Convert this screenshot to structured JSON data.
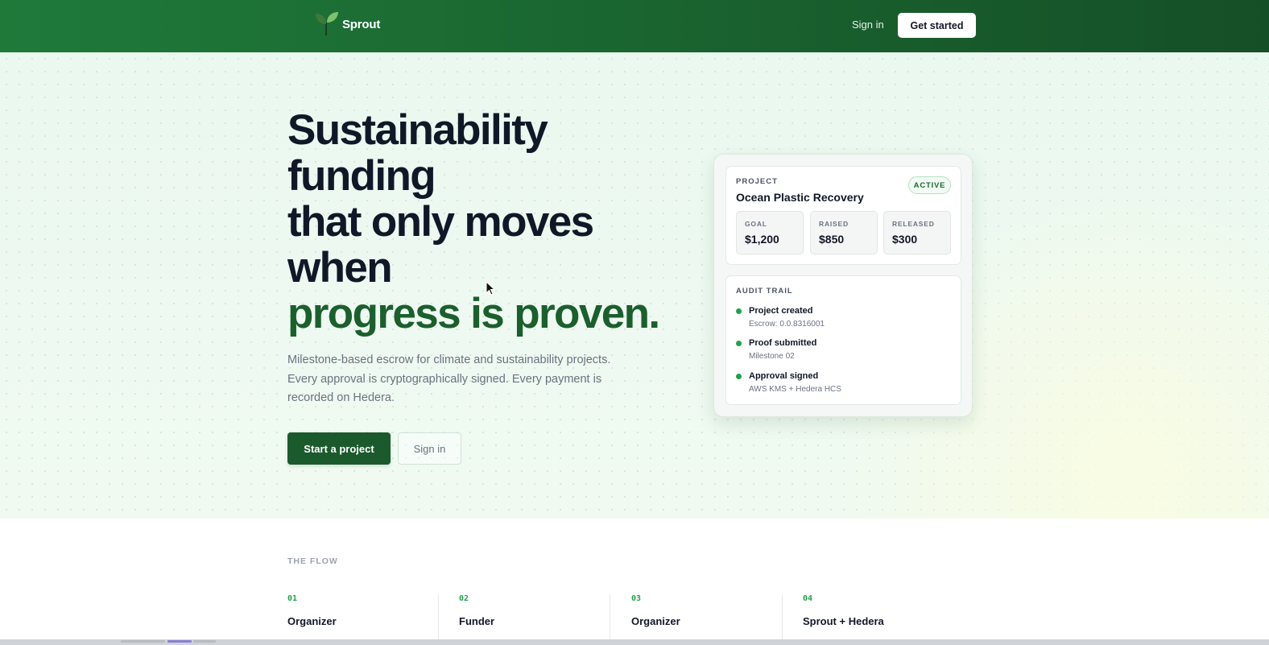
{
  "nav": {
    "brand_name": "Sprout",
    "brand_icon": "sprout-leaf-icon",
    "sign_in": "Sign in",
    "cta": "Get started"
  },
  "hero": {
    "headline_lines": [
      "Sustainability",
      "funding",
      "that only moves",
      "when"
    ],
    "headline_accent": "progress is proven.",
    "subtext": "Milestone-based escrow for climate and sustainability projects. Every approval is cryptographically signed. Every payment is recorded on Hedera.",
    "primary_button": "Start a project",
    "secondary_button": "Sign in"
  },
  "card": {
    "project_eyebrow": "PROJECT",
    "project_name": "Ocean Plastic Recovery",
    "status_badge": "ACTIVE",
    "stats": [
      {
        "label": "GOAL",
        "value": "$1,200"
      },
      {
        "label": "RAISED",
        "value": "$850"
      },
      {
        "label": "RELEASED",
        "value": "$300"
      }
    ],
    "audit_eyebrow": "AUDIT TRAIL",
    "audit_items": [
      {
        "title": "Project created",
        "sub": "Escrow: 0.0.8316001"
      },
      {
        "title": "Proof submitted",
        "sub": "Milestone 02"
      },
      {
        "title": "Approval signed",
        "sub": "AWS KMS + Hedera HCS"
      }
    ]
  },
  "flow": {
    "label": "THE FLOW",
    "steps": [
      {
        "num": "01",
        "role": "Organizer",
        "desc": ""
      },
      {
        "num": "02",
        "role": "Funder",
        "desc": ""
      },
      {
        "num": "03",
        "role": "Organizer",
        "desc": ""
      },
      {
        "num": "04",
        "role": "Sprout + Hedera",
        "desc": ""
      }
    ]
  },
  "colors": {
    "nav_green": "#1f7a3a",
    "accent_green": "#1b5f2d",
    "status_dot": "#22a14a"
  }
}
